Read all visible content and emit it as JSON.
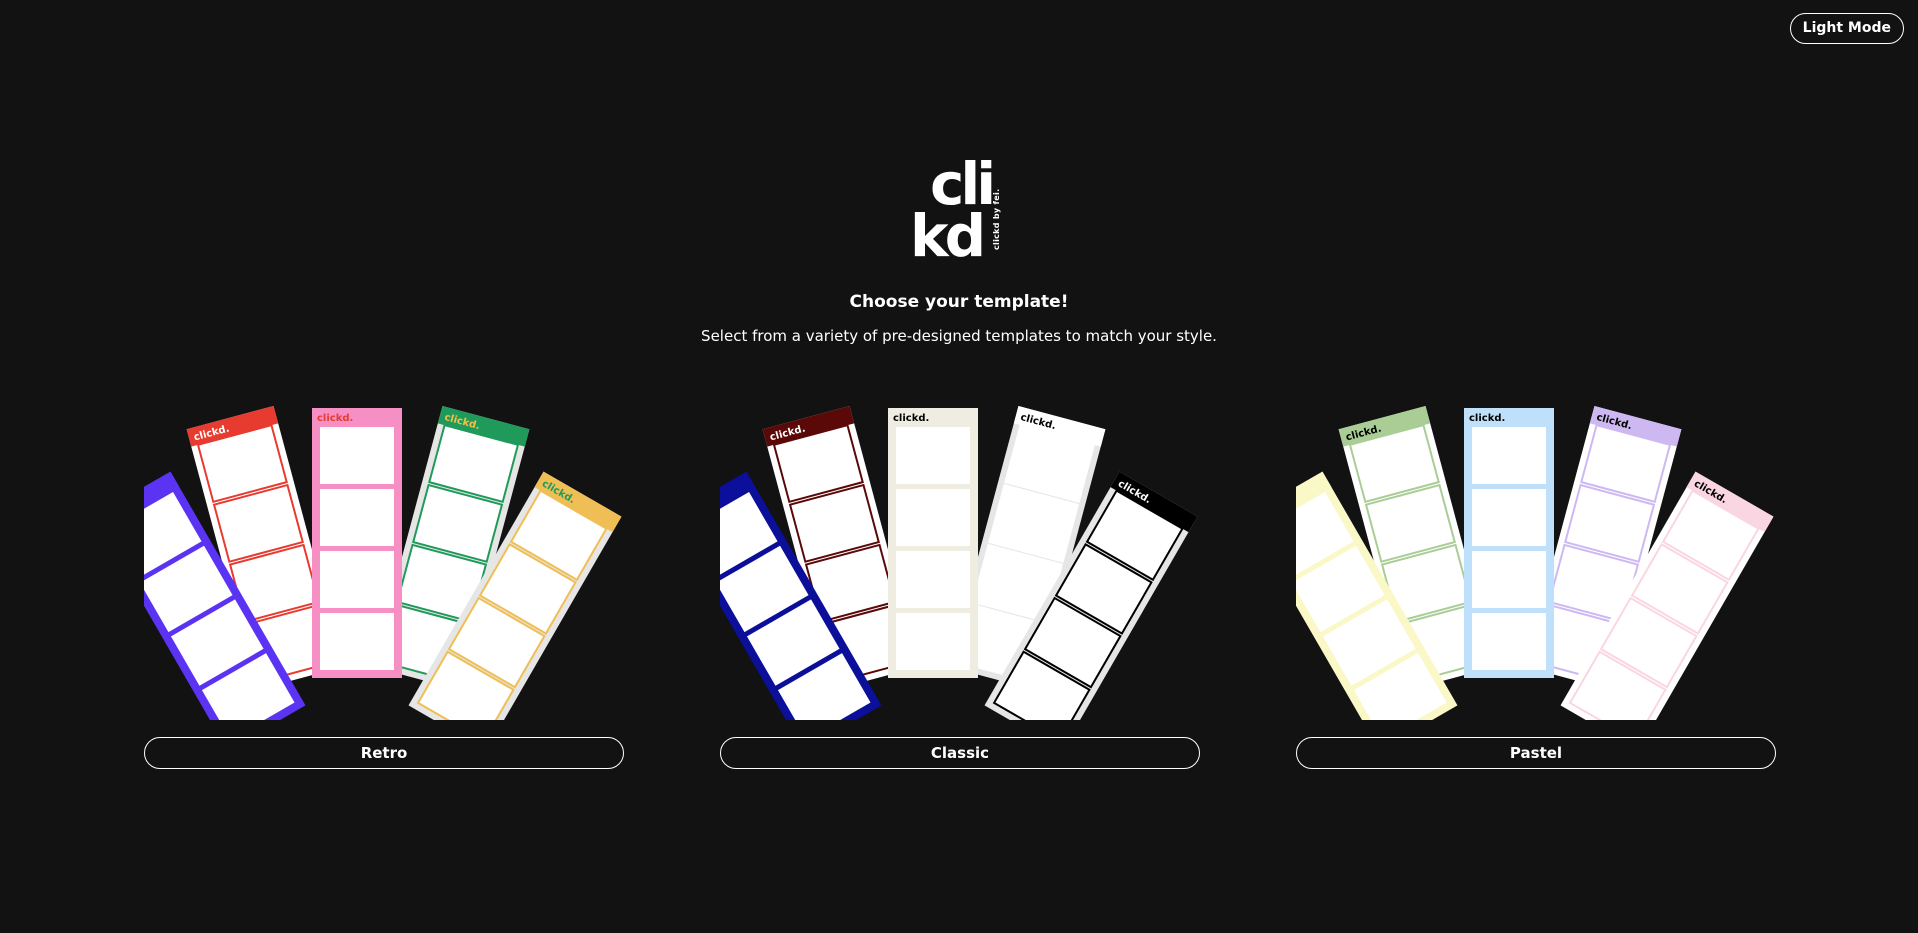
{
  "header": {
    "mode_toggle_label": "Light Mode"
  },
  "logo": {
    "row1": "cli",
    "row2": "kd",
    "tagline": "clickd by fei."
  },
  "intro": {
    "title": "Choose your template!",
    "subtitle": "Select from a variety of pre-designed templates to match your style."
  },
  "strip_brand": "clickd.",
  "templates": [
    {
      "name": "Retro",
      "strips": [
        {
          "frame": "#5b33f2",
          "line": "#5b33f2",
          "brand": "#ffffff",
          "header": "#5b33f2"
        },
        {
          "frame": "#ffffff",
          "line": "#e63b2e",
          "brand": "#ffffff",
          "header": "#e63b2e"
        },
        {
          "frame": "#f58fc4",
          "line": "#f58fc4",
          "brand": "#e63b2e",
          "header": "#f58fc4"
        },
        {
          "frame": "#e6e6e6",
          "line": "#1f9a5a",
          "brand": "#f2c14e",
          "header": "#1f9a5a"
        },
        {
          "frame": "#e6e6e6",
          "line": "#efbf55",
          "brand": "#1f9a5a",
          "header": "#efbf55"
        }
      ]
    },
    {
      "name": "Classic",
      "strips": [
        {
          "frame": "#0b0f99",
          "line": "#0b0f99",
          "brand": "#ffffff",
          "header": "#0b0f99"
        },
        {
          "frame": "#ffffff",
          "line": "#5a0808",
          "brand": "#ffffff",
          "header": "#5a0808"
        },
        {
          "frame": "#efede2",
          "line": "#efede2",
          "brand": "#000000",
          "header": "#efede2"
        },
        {
          "frame": "#e6e6e6",
          "line": "#ffffff",
          "brand": "#000000",
          "header": "#ffffff"
        },
        {
          "frame": "#e6e6e6",
          "line": "#000000",
          "brand": "#ffffff",
          "header": "#000000"
        }
      ]
    },
    {
      "name": "Pastel",
      "strips": [
        {
          "frame": "#fbf8c8",
          "line": "#fbf8c8",
          "brand": "#000000",
          "header": "#fbf8c8"
        },
        {
          "frame": "#ffffff",
          "line": "#a9cd95",
          "brand": "#000000",
          "header": "#a9cd95"
        },
        {
          "frame": "#bfe0fb",
          "line": "#bfe0fb",
          "brand": "#000000",
          "header": "#bfe0fb"
        },
        {
          "frame": "#ffffff",
          "line": "#cdb8f2",
          "brand": "#000000",
          "header": "#cdb8f2"
        },
        {
          "frame": "#ffffff",
          "line": "#fad6e2",
          "brand": "#000000",
          "header": "#fad6e2"
        }
      ]
    }
  ]
}
